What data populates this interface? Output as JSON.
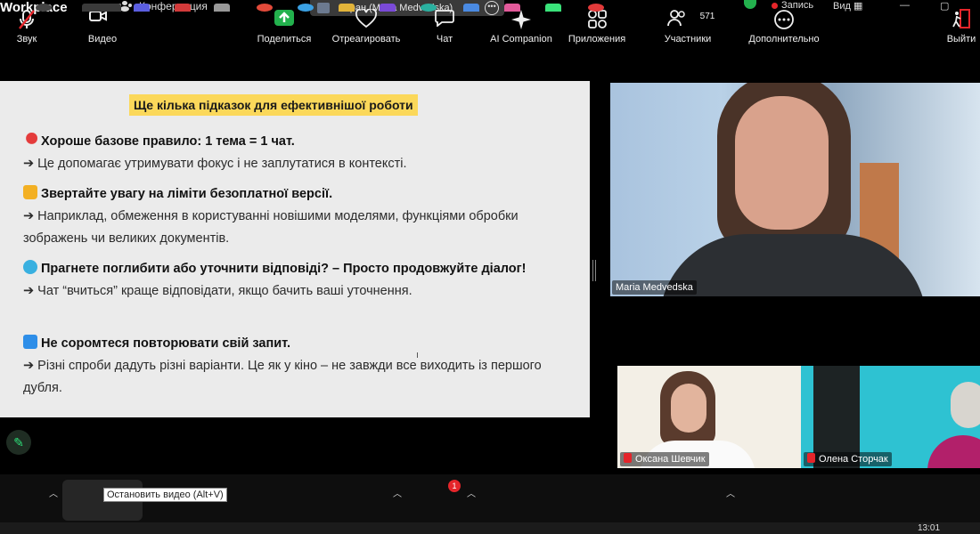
{
  "topbar": {
    "app_title": "Workplace",
    "meeting_label": "Конференция",
    "screen_share_label": "Экран (Maria Medvedska)",
    "record_label": "Запись",
    "view_label": "Вид"
  },
  "slide": {
    "title": "Ще кілька підказок для ефективнішої роботи",
    "tips": [
      {
        "head": "Хороше базове правило: 1 тема = 1 чат.",
        "body": "➔ Це допомагає утримувати фокус і не заплутатися в контексті."
      },
      {
        "head": "Звертайте увагу на ліміти безоплатної версії.",
        "body": "➔ Наприклад, обмеження в користуванні новішими моделями, функціями обробки зображень чи великих документів."
      },
      {
        "head": "Прагнете поглибити або уточнити відповіді? – Просто продовжуйте діалог!",
        "body": "➔ Чат “вчиться” краще відповідати, якщо бачить ваші уточнення."
      },
      {
        "head": "Не соромтеся повторювати свій запит.",
        "body": "➔ Різні спроби дадуть різні варіанти. Це як у кіно – не завжди все виходить із першого дубля."
      }
    ]
  },
  "participants": {
    "speaker": "Maria Medvedska",
    "tile1": "Оксана Шевчик",
    "tile2": "Олена Сторчак"
  },
  "toolbar": {
    "audio": "Звук",
    "video": "Видео",
    "video_tooltip": "Остановить видео (Alt+V)",
    "share": "Поделиться",
    "react": "Отреагировать",
    "chat": "Чат",
    "chat_badge": "1",
    "ai": "AI Companion",
    "apps": "Приложения",
    "participants": "Участники",
    "participants_count": "571",
    "more": "Дополнительно",
    "leave": "Выйти"
  },
  "taskbar": {
    "time": "13:01"
  },
  "colors": {
    "accent_green": "#23b14d",
    "slide_highlight": "#fbd85a",
    "alert_red": "#e5252a"
  }
}
